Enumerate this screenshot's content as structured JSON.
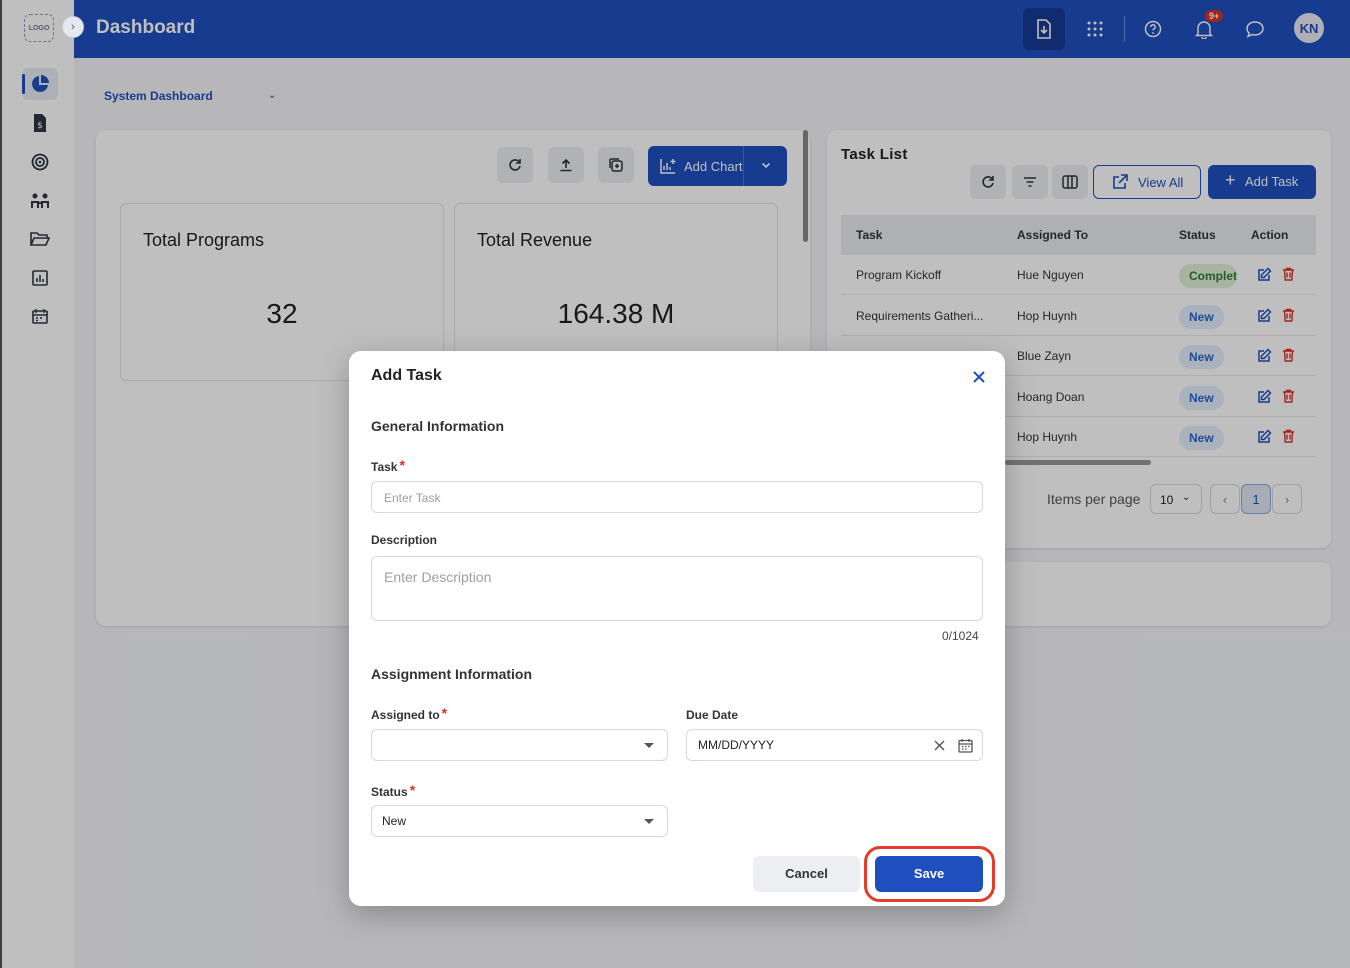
{
  "app": {
    "logo_text": "LOGO",
    "title": "Dashboard"
  },
  "header": {
    "notification_count": "9+",
    "avatar_initials": "KN"
  },
  "dashboard": {
    "selected": "System Dashboard"
  },
  "toolbar": {
    "add_chart_label": "Add Chart"
  },
  "kpis": [
    {
      "title": "Total Programs",
      "value": "32"
    },
    {
      "title": "Total Revenue",
      "value": "164.38 M"
    }
  ],
  "task_list": {
    "title": "Task List",
    "view_all_label": "View All",
    "add_task_label": "Add Task",
    "columns": [
      "Task",
      "Assigned To",
      "Status",
      "Action"
    ],
    "rows": [
      {
        "task": "Program Kickoff",
        "assigned": "Hue Nguyen",
        "status": "Completed"
      },
      {
        "task": "Requirements Gatheri...",
        "assigned": "Hop Huynh",
        "status": "New"
      },
      {
        "task": "",
        "assigned": "Blue Zayn",
        "status": "New"
      },
      {
        "task": "",
        "assigned": "Hoang Doan",
        "status": "New"
      },
      {
        "task": "",
        "assigned": "Hop Huynh",
        "status": "New"
      }
    ],
    "items_per_page_label": "Items per page",
    "items_per_page": "10",
    "current_page": "1"
  },
  "modal": {
    "title": "Add Task",
    "general_section": "General Information",
    "task_label": "Task",
    "task_placeholder": "Enter Task",
    "description_label": "Description",
    "description_placeholder": "Enter Description",
    "description_counter": "0/1024",
    "assignment_section": "Assignment Information",
    "assigned_label": "Assigned to",
    "assigned_value": "",
    "due_label": "Due Date",
    "due_placeholder": "MM/DD/YYYY",
    "status_label": "Status",
    "status_value": "New",
    "required_mark": "*",
    "cancel_label": "Cancel",
    "save_label": "Save"
  },
  "colors": {
    "primary": "#1f4fbf",
    "highlight": "#e53b2a",
    "required": "#d93025"
  }
}
